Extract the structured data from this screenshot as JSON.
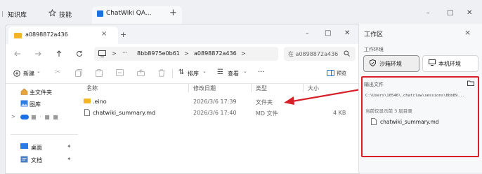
{
  "browser_tabs": {
    "tab1": "知识库",
    "tab2": "技能",
    "tab3": "ChatWiki QA...",
    "new_tab": "+"
  },
  "window_controls": {
    "minimize": "–",
    "maximize": "□",
    "close": "✕"
  },
  "explorer": {
    "tab_title": "a0898872a436",
    "tab_close": "×",
    "tab_add": "+",
    "breadcrumb": {
      "more": "···",
      "seg1": "8bb8975e0b61",
      "arrow1": ">",
      "seg2": "a0898872a436",
      "arrow2": ">"
    },
    "search_placeholder": "在 a0898872a436",
    "toolbar": {
      "new": "新建",
      "sort": "排序",
      "view": "查看",
      "more": "···",
      "preview": "预览"
    },
    "columns": {
      "name": "名称",
      "modified": "修改日期",
      "type": "类型",
      "size": "大小"
    },
    "sidebar": {
      "home": "主文件夹",
      "gallery": "图库",
      "cloud": "■ · ■ ■",
      "desktop": "桌面",
      "documents": "文档"
    },
    "files": [
      {
        "name": ".eino",
        "modified": "2026/3/6 17:39",
        "type": "文件夹",
        "size": ""
      },
      {
        "name": "chatwiki_summary.md",
        "modified": "2026/3/6 17:40",
        "type": "MD 文件",
        "size": "4 KB"
      }
    ]
  },
  "workspace": {
    "title": "工作区",
    "close": "×",
    "env_label": "工作环境",
    "env_sandbox": "沙箱环境",
    "env_local": "本机环境",
    "output_label": "输出文件",
    "output_path": "C:\\Users\\10546\\.chatclaw\\sessions\\8bb89...",
    "levels_text": "当前仅显示前 3 层目录",
    "output_file": "chatwiki_summary.md"
  },
  "colors": {
    "highlight_red": "#d6212a",
    "accent_blue": "#1a6fd6"
  }
}
